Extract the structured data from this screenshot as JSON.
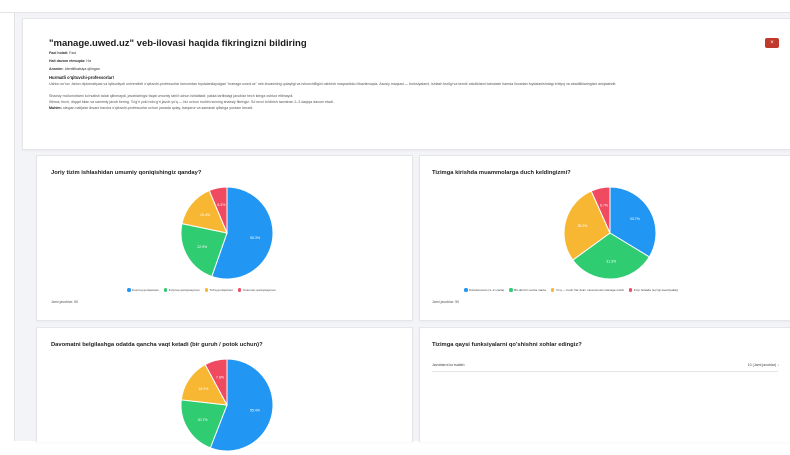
{
  "survey": {
    "title": "\"manage.uwed.uz\" veb-ilovasi haqida fikringizni bildiring",
    "action_button_icon": "close-icon",
    "status_label": "Faol holati:",
    "status_value": "Faol",
    "in_progress_label": "Hali davom etmoqda:",
    "in_progress_value": "Ha",
    "anonymity_label": "Anonim:",
    "anonymity_value": "Identifikatsiya qilingan",
    "greeting": "Hurmatli o'qituvchi-professorlar!",
    "paragraphs": [
      "Ushbu so'rov Jahon diplomatiyasi va iqtisodiyoti universiteti o'qituvchi-professorlar tomonidan foydalanilayotgan \"manage.uwed.uz\" veb-ilovasining qulayligi va ishonchliligini oshirish maqsadida o'tkazilmoqda. Asosiy maqsad — funksiyalarni, ishlash tezligi va texnik xatoliklarni baholash hamda ilovadan foydalanishdagi ehtiyoj va abadiliklaringizni aniqlashdir.",
      "Shaxsiy ma'lumotlarni ko'rsatish talab qilinmaydi, javoblaringiz faqat umumiy tahlil uchun ishlatiladi; yakka tartibdagi javoblar hech kimga oshkor etilmaydi.",
      "Iltimos, tinch, diqqat bilan va samimiy javob bering. To'g'ri yoki noto'g'ri javob yo'q — biz uchun muhim sizning shaxsiy fikringiz. So'rovni to'ldirish taxminan 2–3 daqiqa davom etadi."
    ],
    "important_label": "Muhim:",
    "important_text": "olingan natijalar ilovani barcha o'qituvchi-professorlar uchun yanada qulay, barqaror va samarali qilishga yordam beradi."
  },
  "questions": [
    {
      "title": "Joriy tizim ishlashidan umumiy qoniqishingiz qanday?",
      "total": "Jami javoblar: 50"
    },
    {
      "title": "Tizimga kirishda muammolarga duch keldingizmi?",
      "total": "Jami javoblar: 50"
    },
    {
      "title": "Davomatni belgilashga odatda qancha vaqt ketadi (bir guruh / potok uchun)?"
    },
    {
      "title": "Tizimga qaysi funksiyalarni qo'shishni xohlar edingiz?",
      "table_header": "Javoblarni ko'rsatish",
      "table_count": "10 (Jami javoblar) ↓"
    }
  ],
  "chart_data": [
    {
      "type": "pie",
      "title": "Joriy tizim ishlashidan umumiy qoniqishingiz qanday?",
      "categories": [
        "Ko'proq qoniqaman",
        "Ko'proq qoniqmayman",
        "To'liq qoniqaman",
        "Umuman qoniqmayman"
      ],
      "values": [
        55.3,
        22.9,
        15.4,
        6.3
      ],
      "labels": [
        "55.3%",
        "22.9%",
        "15.4%",
        "6.3%"
      ],
      "colors": [
        "#2196f3",
        "#2fcc71",
        "#f7b733",
        "#ef4a60"
      ],
      "legend": "bottom"
    },
    {
      "type": "pie",
      "title": "Tizimga kirishda muammolarga duch keldingizmi?",
      "categories": [
        "Kamdan-kam (1–2 marta)",
        "Bir-ikki bir necha marta",
        "Yo'q — hech har doim muammosiz ulanaga oxirdi",
        "Ko'p holatda (so'ngi savoliyatlar)"
      ],
      "values": [
        33.7,
        31.3,
        28.3,
        6.7
      ],
      "labels": [
        "33.7%",
        "31.3%",
        "28.3%",
        "6.7%"
      ],
      "colors": [
        "#2196f3",
        "#2fcc71",
        "#f7b733",
        "#ef4a60"
      ],
      "legend": "bottom"
    },
    {
      "type": "pie",
      "title": "Davomatni belgilashga odatda qancha vaqt ketadi (bir guruh / potok uchun)?",
      "categories": [],
      "values": [
        55.4,
        20.7,
        15.2,
        7.8
      ],
      "labels": [
        "55.4%",
        "20.7%",
        "15.2%",
        "7.8%"
      ],
      "colors": [
        "#2196f3",
        "#2fcc71",
        "#f7b733",
        "#ef4a60"
      ]
    }
  ]
}
